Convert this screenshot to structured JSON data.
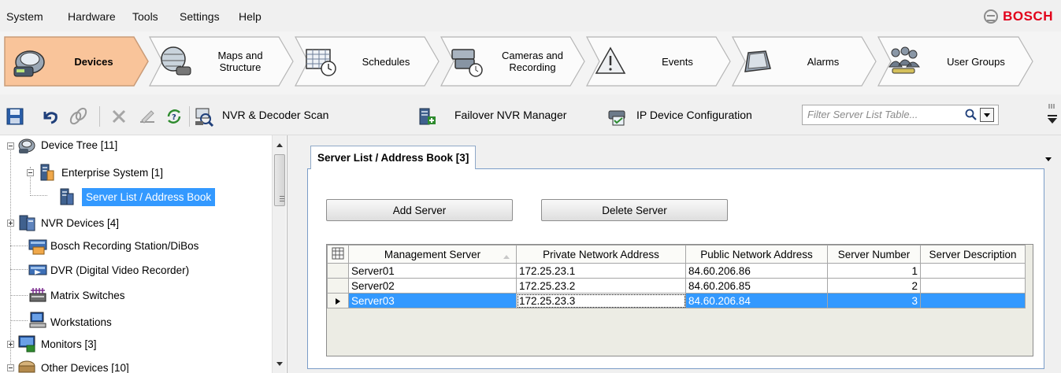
{
  "menu": [
    "System",
    "Hardware",
    "Tools",
    "Settings",
    "Help"
  ],
  "brand": "BOSCH",
  "nav_tabs": [
    {
      "label": "Devices",
      "icon": "devices-icon",
      "active": true
    },
    {
      "label": "Maps and\nStructure",
      "icon": "maps-icon",
      "active": false
    },
    {
      "label": "Schedules",
      "icon": "schedules-icon",
      "active": false
    },
    {
      "label": "Cameras and\nRecording",
      "icon": "cameras-icon",
      "active": false
    },
    {
      "label": "Events",
      "icon": "events-icon",
      "active": false
    },
    {
      "label": "Alarms",
      "icon": "alarms-icon",
      "active": false
    },
    {
      "label": "User Groups",
      "icon": "user-groups-icon",
      "active": false
    }
  ],
  "toolbar": {
    "nvr_scan": "NVR & Decoder Scan",
    "failover": "Failover NVR Manager",
    "ip_config": "IP Device Configuration",
    "filter_placeholder": "Filter Server List Table..."
  },
  "tree": {
    "root": "Device Tree [11]",
    "enterprise": "Enterprise System [1]",
    "server_list": "Server List / Address Book",
    "nvr": "NVR Devices [4]",
    "brs": "Bosch Recording Station/DiBos",
    "dvr": "DVR (Digital Video Recorder)",
    "matrix": "Matrix Switches",
    "workstations": "Workstations",
    "monitors": "Monitors [3]",
    "other": "Other Devices [10]"
  },
  "panel": {
    "tab_title": "Server List / Address Book [3]",
    "add_button": "Add Server",
    "delete_button": "Delete Server"
  },
  "table": {
    "columns": [
      "Management Server",
      "Private Network Address",
      "Public Network Address",
      "Server Number",
      "Server Description"
    ],
    "rows": [
      {
        "name": "Server01",
        "private": "172.25.23.1",
        "public": "84.60.206.86",
        "number": "1",
        "description": ""
      },
      {
        "name": "Server02",
        "private": "172.25.23.2",
        "public": "84.60.206.85",
        "number": "2",
        "description": ""
      },
      {
        "name": "Server03",
        "private": "172.25.23.3",
        "public": "84.60.206.84",
        "number": "3",
        "description": ""
      }
    ],
    "selected_row": 2
  },
  "colors": {
    "accent_active_tab": "#f9c49a",
    "selection": "#3399ff",
    "brand": "#e2001a"
  }
}
